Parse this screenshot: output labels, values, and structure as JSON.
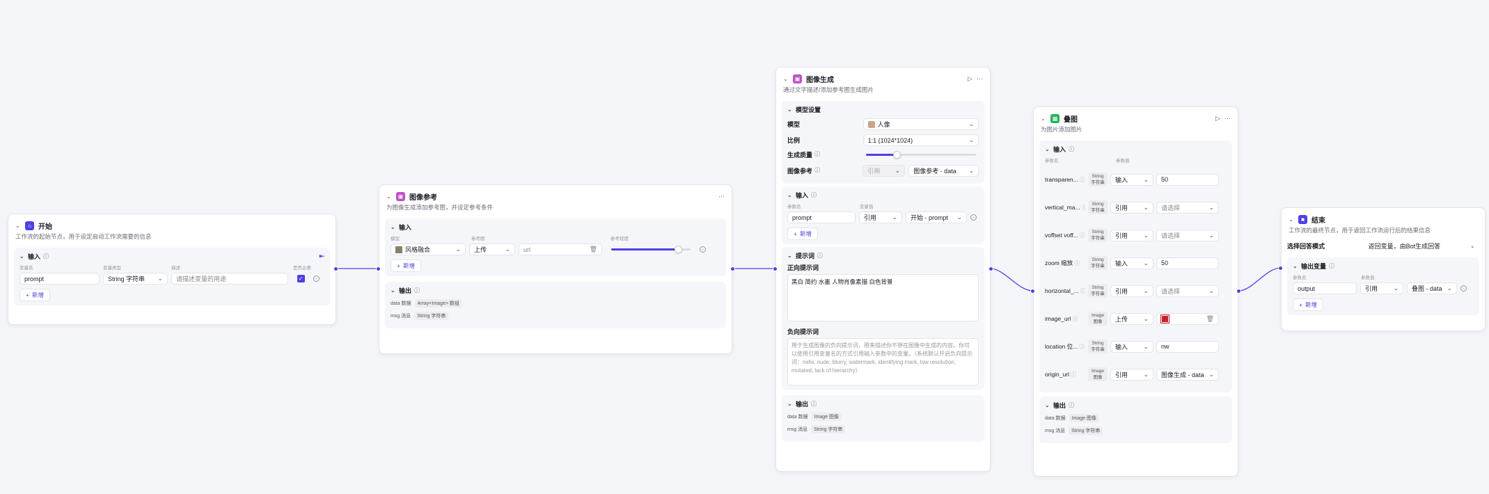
{
  "colors": {
    "accent": "#4e40e5",
    "start": "#4e40e5",
    "imgref": "#c04ec8",
    "imggen": "#c04ec8",
    "overlay": "#22b35e",
    "end": "#4e40e5"
  },
  "start": {
    "title": "开始",
    "desc": "工作流的起始节点，用于设定启动工作流需要的信息",
    "input_label": "输入",
    "cols": [
      "变量名",
      "变量类型",
      "描述",
      "是否必要"
    ],
    "row": {
      "name": "prompt",
      "type": "String 字符串",
      "desc_placeholder": "请描述变量的用途"
    },
    "add_label": "新增"
  },
  "imgref": {
    "title": "图像参考",
    "desc": "为图像生成添加参考图，并设定参考条件",
    "input_label": "输入",
    "cols": [
      "模型",
      "参考图",
      "",
      "参考程度"
    ],
    "row": {
      "model": "风格融合",
      "mode": "上传",
      "url": "url",
      "strength": 0.84
    },
    "add_label": "新增",
    "output_label": "输出",
    "outputs": [
      {
        "name": "data 数据",
        "type": "Array<Image> 数组"
      },
      {
        "name": "msg 消息",
        "type": "String 字符串"
      }
    ]
  },
  "imggen": {
    "title": "图像生成",
    "desc": "通过文字描述/添加参考图生成图片",
    "model_section": "模型设置",
    "model_label": "模型",
    "model_value": "人像",
    "ratio_label": "比例",
    "ratio_value": "1:1 (1024*1024)",
    "quality_label": "生成质量",
    "quality_value": 0.28,
    "ref_label": "图像参考",
    "ref_mode": "引用",
    "ref_value": "图像参考 - data",
    "input_label": "输入",
    "cols": [
      "参数名",
      "变量值"
    ],
    "row": {
      "name": "prompt",
      "mode": "引用",
      "value": "开始 - prompt"
    },
    "add_label": "新增",
    "prompt_section": "提示词",
    "pos_label": "正向提示词",
    "pos_value": "黑白 简约 水墨 人物肖像素描 白色背景",
    "neg_label": "负向提示词",
    "neg_placeholder": "用于生成图像的负向提示词，用来描述你不想在图像中生成的内容。你可以使用引用变量名的方式引用输入参数中的变量。（系统默认开启负向提示词：nsfw, nude, blurry, watermark, identifying mark, low resolution, mutated, lack of hierarchy）",
    "output_label": "输出",
    "outputs": [
      {
        "name": "data 数据",
        "type": "Image 图像"
      },
      {
        "name": "msg 消息",
        "type": "String 字符串"
      }
    ]
  },
  "overlay": {
    "title": "叠图",
    "desc": "为图片添加图片",
    "input_label": "输入",
    "cols": [
      "参数名",
      "参数值"
    ],
    "rows": [
      {
        "name": "transparen...",
        "type": "String 字符串",
        "mode": "输入",
        "value": "50",
        "placeholder": false
      },
      {
        "name": "vertical_ma...",
        "type": "String 字符串",
        "mode": "引用",
        "value": "请选择",
        "placeholder": true
      },
      {
        "name": "voffset voff...",
        "type": "String 字符串",
        "mode": "引用",
        "value": "请选择",
        "placeholder": true
      },
      {
        "name": "zoom 缩放",
        "type": "String 字符串",
        "mode": "输入",
        "value": "50",
        "placeholder": false
      },
      {
        "name": "horizontal_...",
        "type": "String 字符串",
        "mode": "引用",
        "value": "请选择",
        "placeholder": true
      },
      {
        "name": "image_url",
        "type": "Image 图像",
        "mode": "上传",
        "value": "",
        "placeholder": false
      },
      {
        "name": "location 位...",
        "type": "String 字符串",
        "mode": "输入",
        "value": "nw",
        "placeholder": false
      },
      {
        "name": "origin_url",
        "type": "Image 图像",
        "mode": "引用",
        "value": "图像生成 - data",
        "placeholder": false
      }
    ],
    "output_label": "输出",
    "outputs": [
      {
        "name": "data 数据",
        "type": "Image 图像"
      },
      {
        "name": "msg 消息",
        "type": "String 字符串"
      }
    ]
  },
  "end": {
    "title": "结束",
    "desc": "工作流的最终节点，用于返回工作流运行后的结果信息",
    "mode_label": "选择回答模式",
    "mode_value": "返回变量，由Bot生成回答",
    "output_label": "输出变量",
    "cols": [
      "参数名",
      "参数值"
    ],
    "row": {
      "name": "output",
      "mode": "引用",
      "value": "叠图 - data"
    },
    "add_label": "新增"
  }
}
